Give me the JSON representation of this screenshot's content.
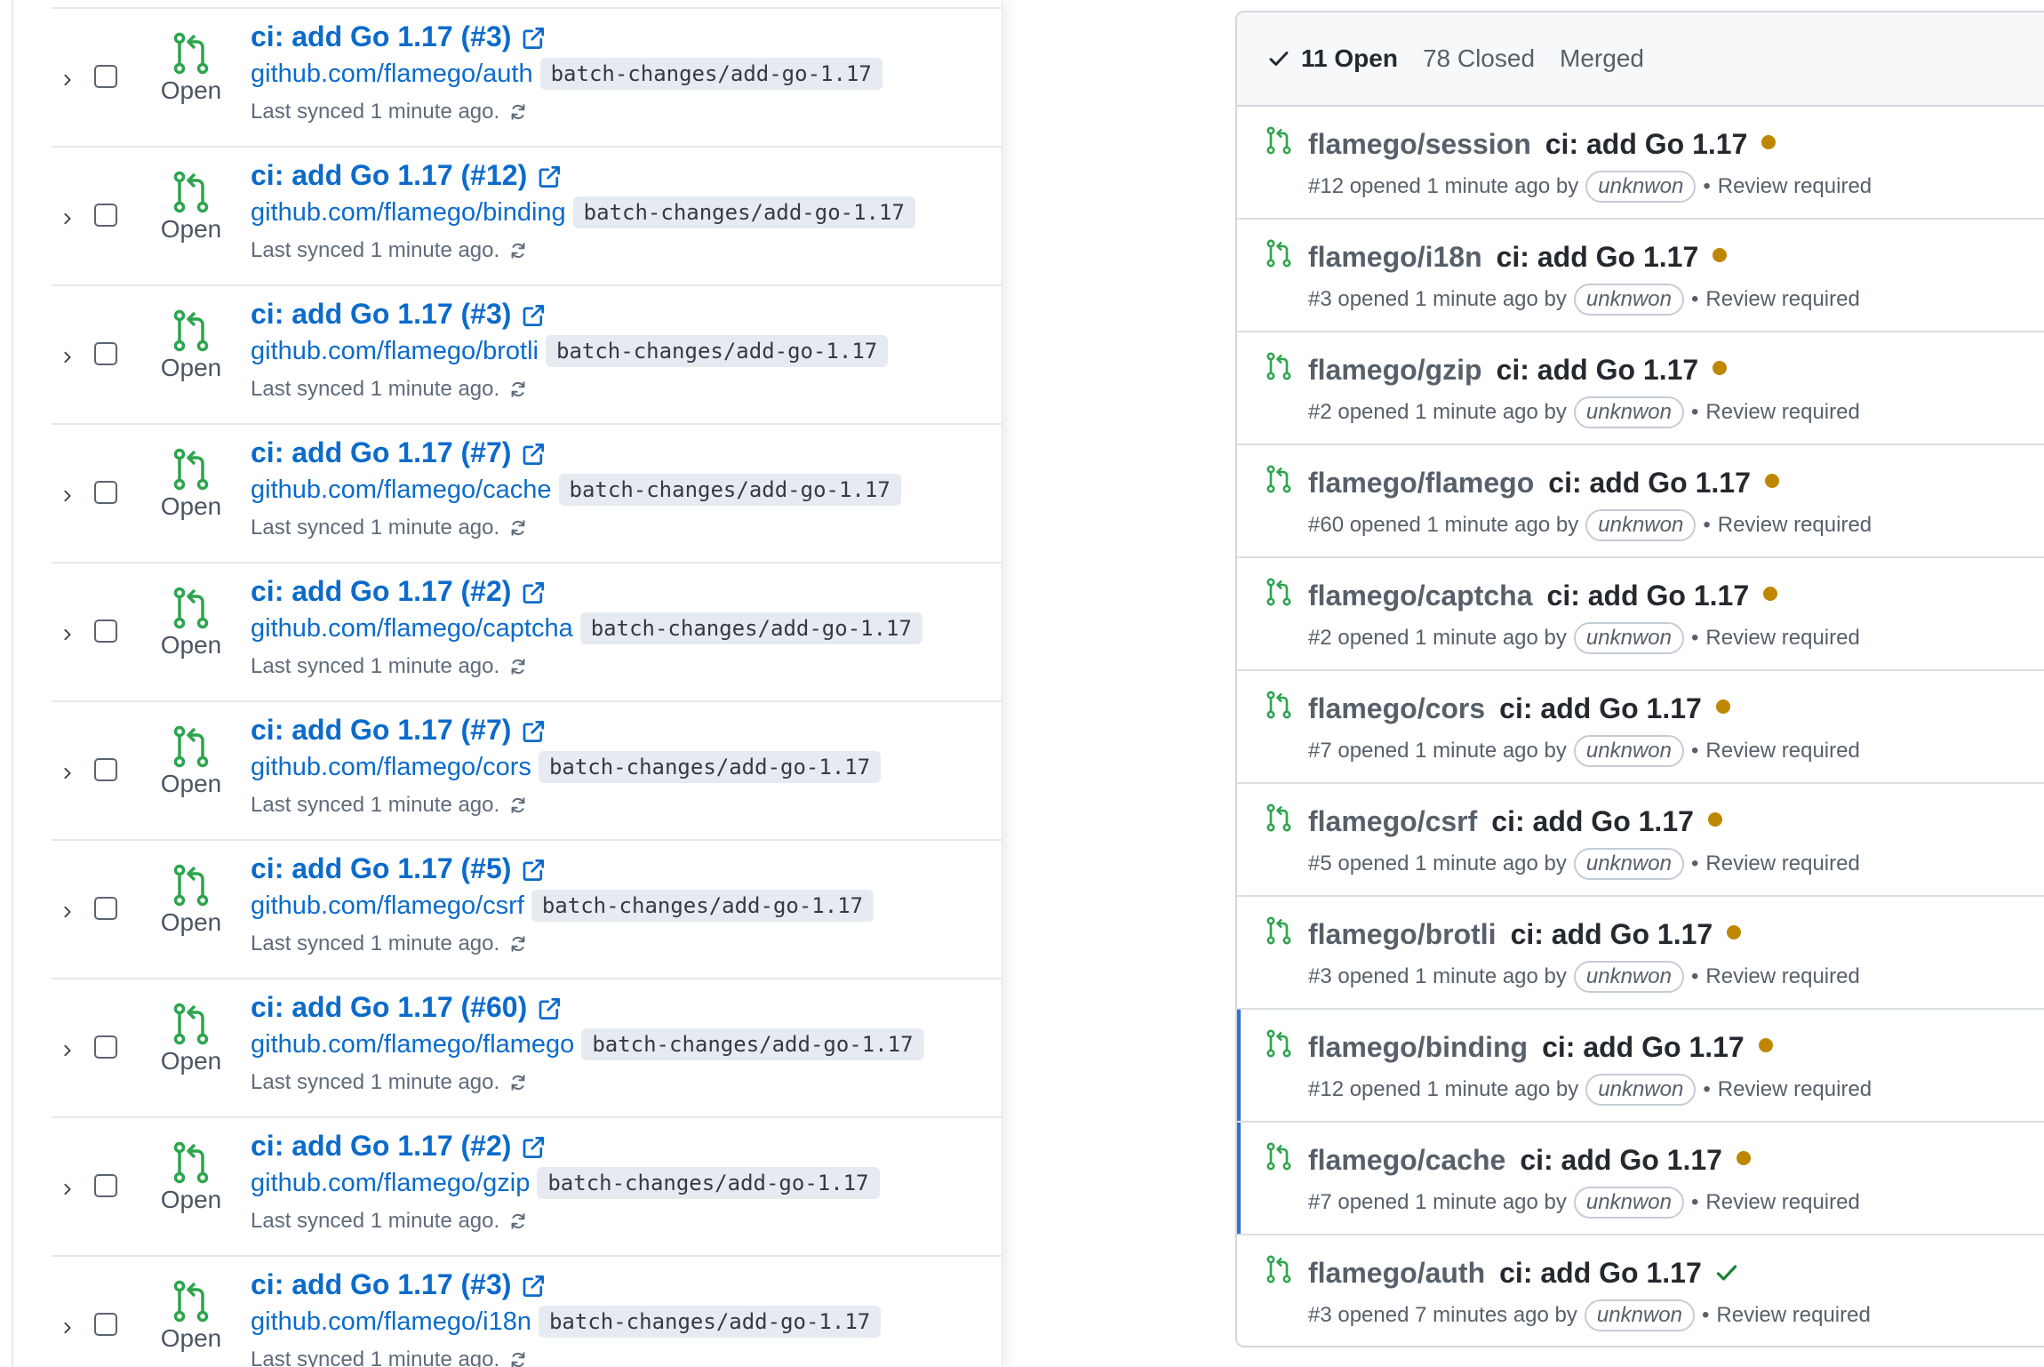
{
  "colors": {
    "link_blue": "#0b6bcb",
    "open_green": "#2da44e",
    "pending_dot": "#bf8700",
    "success_check": "#1a7f37",
    "selected_bar": "#2f6fd6"
  },
  "changesets": [
    {
      "title": "ci: add Go 1.17 (#3)",
      "repo": "github.com/flamego/auth",
      "branch": "batch-changes/add-go-1.17",
      "state": "Open",
      "sync": "Last synced 1 minute ago."
    },
    {
      "title": "ci: add Go 1.17 (#12)",
      "repo": "github.com/flamego/binding",
      "branch": "batch-changes/add-go-1.17",
      "state": "Open",
      "sync": "Last synced 1 minute ago."
    },
    {
      "title": "ci: add Go 1.17 (#3)",
      "repo": "github.com/flamego/brotli",
      "branch": "batch-changes/add-go-1.17",
      "state": "Open",
      "sync": "Last synced 1 minute ago."
    },
    {
      "title": "ci: add Go 1.17 (#7)",
      "repo": "github.com/flamego/cache",
      "branch": "batch-changes/add-go-1.17",
      "state": "Open",
      "sync": "Last synced 1 minute ago."
    },
    {
      "title": "ci: add Go 1.17 (#2)",
      "repo": "github.com/flamego/captcha",
      "branch": "batch-changes/add-go-1.17",
      "state": "Open",
      "sync": "Last synced 1 minute ago."
    },
    {
      "title": "ci: add Go 1.17 (#7)",
      "repo": "github.com/flamego/cors",
      "branch": "batch-changes/add-go-1.17",
      "state": "Open",
      "sync": "Last synced 1 minute ago."
    },
    {
      "title": "ci: add Go 1.17 (#5)",
      "repo": "github.com/flamego/csrf",
      "branch": "batch-changes/add-go-1.17",
      "state": "Open",
      "sync": "Last synced 1 minute ago."
    },
    {
      "title": "ci: add Go 1.17 (#60)",
      "repo": "github.com/flamego/flamego",
      "branch": "batch-changes/add-go-1.17",
      "state": "Open",
      "sync": "Last synced 1 minute ago."
    },
    {
      "title": "ci: add Go 1.17 (#2)",
      "repo": "github.com/flamego/gzip",
      "branch": "batch-changes/add-go-1.17",
      "state": "Open",
      "sync": "Last synced 1 minute ago."
    },
    {
      "title": "ci: add Go 1.17 (#3)",
      "repo": "github.com/flamego/i18n",
      "branch": "batch-changes/add-go-1.17",
      "state": "Open",
      "sync": "Last synced 1 minute ago."
    }
  ],
  "pr_panel": {
    "tabs": {
      "open": "11 Open",
      "closed": "78 Closed",
      "merged": "Merged"
    },
    "items": [
      {
        "repo": "flamego/session",
        "title": "ci: add Go 1.17",
        "meta": "#12 opened 1 minute ago by",
        "author": "unknwon",
        "review": "Review required",
        "status": "pending",
        "selected": false
      },
      {
        "repo": "flamego/i18n",
        "title": "ci: add Go 1.17",
        "meta": "#3 opened 1 minute ago by",
        "author": "unknwon",
        "review": "Review required",
        "status": "pending",
        "selected": false
      },
      {
        "repo": "flamego/gzip",
        "title": "ci: add Go 1.17",
        "meta": "#2 opened 1 minute ago by",
        "author": "unknwon",
        "review": "Review required",
        "status": "pending",
        "selected": false
      },
      {
        "repo": "flamego/flamego",
        "title": "ci: add Go 1.17",
        "meta": "#60 opened 1 minute ago by",
        "author": "unknwon",
        "review": "Review required",
        "status": "pending",
        "selected": false
      },
      {
        "repo": "flamego/captcha",
        "title": "ci: add Go 1.17",
        "meta": "#2 opened 1 minute ago by",
        "author": "unknwon",
        "review": "Review required",
        "status": "pending",
        "selected": false
      },
      {
        "repo": "flamego/cors",
        "title": "ci: add Go 1.17",
        "meta": "#7 opened 1 minute ago by",
        "author": "unknwon",
        "review": "Review required",
        "status": "pending",
        "selected": false
      },
      {
        "repo": "flamego/csrf",
        "title": "ci: add Go 1.17",
        "meta": "#5 opened 1 minute ago by",
        "author": "unknwon",
        "review": "Review required",
        "status": "pending",
        "selected": false
      },
      {
        "repo": "flamego/brotli",
        "title": "ci: add Go 1.17",
        "meta": "#3 opened 1 minute ago by",
        "author": "unknwon",
        "review": "Review required",
        "status": "pending",
        "selected": false
      },
      {
        "repo": "flamego/binding",
        "title": "ci: add Go 1.17",
        "meta": "#12 opened 1 minute ago by",
        "author": "unknwon",
        "review": "Review required",
        "status": "pending",
        "selected": true
      },
      {
        "repo": "flamego/cache",
        "title": "ci: add Go 1.17",
        "meta": "#7 opened 1 minute ago by",
        "author": "unknwon",
        "review": "Review required",
        "status": "pending",
        "selected": true
      },
      {
        "repo": "flamego/auth",
        "title": "ci: add Go 1.17",
        "meta": "#3 opened 7 minutes ago by",
        "author": "unknwon",
        "review": "Review required",
        "status": "success",
        "selected": false
      }
    ]
  }
}
